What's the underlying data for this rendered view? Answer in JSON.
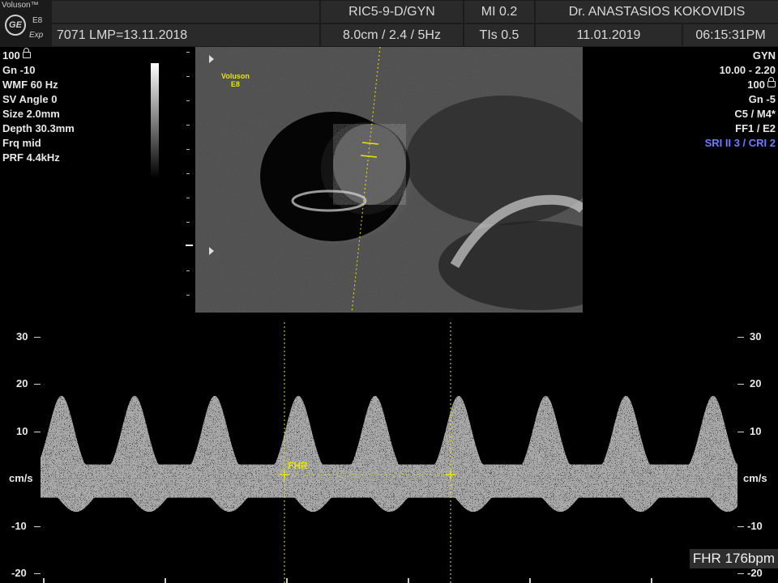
{
  "header": {
    "brand": "Voluson™",
    "logo": "GE",
    "model": "E8",
    "mode": "Exp",
    "patient": "7071  LMP=13.11.2018",
    "probe": "RIC5-9-D/GYN",
    "probe_settings": "8.0cm / 2.4 /  5Hz",
    "mi": "MI  0.2",
    "tis": "TIs  0.5",
    "doctor": "Dr. ANASTASIOS KOKOVIDIS",
    "date": "11.01.2019",
    "time": "06:15:31PM"
  },
  "left_params": [
    "100",
    "Gn -10",
    "WMF 60 Hz",
    "SV Angle  0",
    "Size  2.0mm",
    "Depth 30.3mm",
    "Frq mid",
    "PRF  4.4kHz"
  ],
  "right_params": {
    "preset": "GYN",
    "freq": "10.00 - 2.20",
    "power": "100",
    "gain": "Gn  -5",
    "c_m": "C5 / M4*",
    "ff_e": "FF1 / E2",
    "sri": "SRI II 3 / CRI 2"
  },
  "bmode": {
    "tag_line1": "Voluson",
    "tag_line2": "E8"
  },
  "doppler": {
    "ticks": [
      {
        "label": "30",
        "value": 30
      },
      {
        "label": "20",
        "value": 20
      },
      {
        "label": "10",
        "value": 10
      },
      {
        "label": "cm/s",
        "value": 0
      },
      {
        "label": "-10",
        "value": -10
      },
      {
        "label": "-20",
        "value": -20
      }
    ],
    "range": [
      -22,
      33
    ],
    "peaks_x_fraction": [
      0.03,
      0.135,
      0.25,
      0.37,
      0.48,
      0.6,
      0.725,
      0.84,
      0.965
    ],
    "fhr_label": "FHR",
    "fhr_readout": "FHR 176bpm",
    "accent": "#e8e600"
  }
}
